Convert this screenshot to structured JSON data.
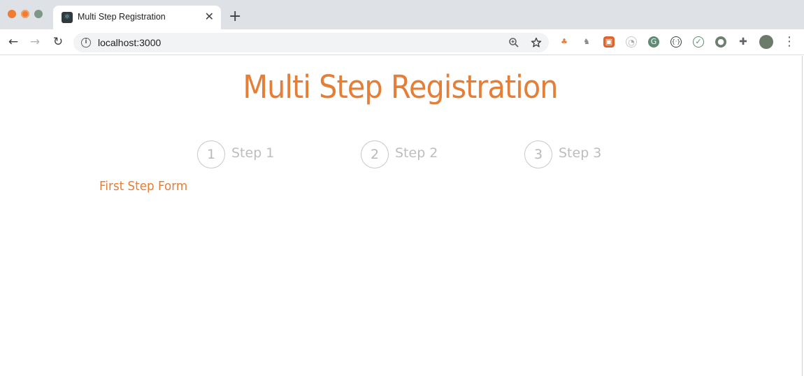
{
  "browser": {
    "tab_title": "Multi Step Registration",
    "url": "localhost:3000"
  },
  "page": {
    "title": "Multi Step Registration",
    "steps": [
      {
        "number": "1",
        "label": "Step 1"
      },
      {
        "number": "2",
        "label": "Step 2"
      },
      {
        "number": "3",
        "label": "Step 3"
      }
    ],
    "form_heading": "First Step Form"
  },
  "colors": {
    "accent": "#e57e36",
    "step_inactive": "#bdbdbd",
    "chrome_bg": "#dee1e6"
  }
}
